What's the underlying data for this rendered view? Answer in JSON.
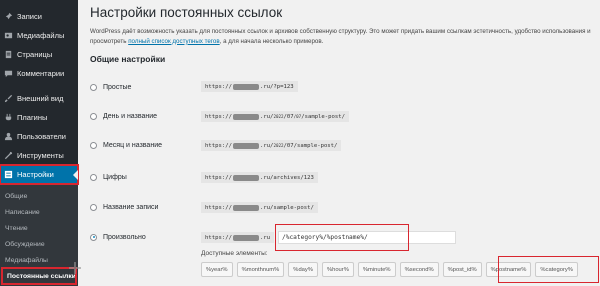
{
  "sidebar": {
    "items": [
      {
        "label": "Записи",
        "icon": "pin-icon"
      },
      {
        "label": "Медиафайлы",
        "icon": "media-icon"
      },
      {
        "label": "Страницы",
        "icon": "pages-icon"
      },
      {
        "label": "Комментарии",
        "icon": "comment-icon"
      },
      {
        "label": "Внешний вид",
        "icon": "brush-icon"
      },
      {
        "label": "Плагины",
        "icon": "plugin-icon"
      },
      {
        "label": "Пользователи",
        "icon": "users-icon"
      },
      {
        "label": "Инструменты",
        "icon": "wrench-icon"
      },
      {
        "label": "Настройки",
        "icon": "settings-icon"
      }
    ],
    "submenu": [
      "Общие",
      "Написание",
      "Чтение",
      "Обсуждение",
      "Медиафайлы",
      "Постоянные ссылки"
    ]
  },
  "page": {
    "title": "Настройки постоянных ссылок",
    "intro_start": "WordPress даёт возможность указать для постоянных ссылок и архивов собственную структуру. Это может придать вашим ссылкам эстетичность, удобство использования и",
    "intro_prefix": "просмотреть ",
    "intro_link": "полный список доступных тегов",
    "intro_end": ", а для начала несколько примеров.",
    "section": "Общие настройки"
  },
  "options": [
    {
      "label": "Простые",
      "pre": "https://",
      "post": ".ru/?p=123"
    },
    {
      "label": "День и название",
      "pre": "https://",
      "post_a": ".ru/",
      "small": "2022",
      "mid": "/07",
      "small2": "/07",
      "post_b": "/sample-post/"
    },
    {
      "label": "Месяц и название",
      "pre": "https://",
      "post_a": ".ru/",
      "small": "2022",
      "post_b": "/07/sample-post/"
    },
    {
      "label": "Цифры",
      "pre": "https://",
      "post": ".ru/archives/123"
    },
    {
      "label": "Название записи",
      "pre": "https://",
      "post": ".ru/sample-post/"
    },
    {
      "label": "Произвольно",
      "pre": "https://",
      "post": ".ru",
      "checked": true
    }
  ],
  "custom_structure": "/%category%/%postname%/",
  "available_label": "Доступные элементы:",
  "tags": [
    "%year%",
    "%monthnum%",
    "%day%",
    "%hour%",
    "%minute%",
    "%second%",
    "%post_id%",
    "%postname%",
    "%category%"
  ],
  "colors": {
    "sidebar": "#23282d",
    "active": "#0073aa",
    "highlight": "#d8262f",
    "link": "#0073aa"
  }
}
